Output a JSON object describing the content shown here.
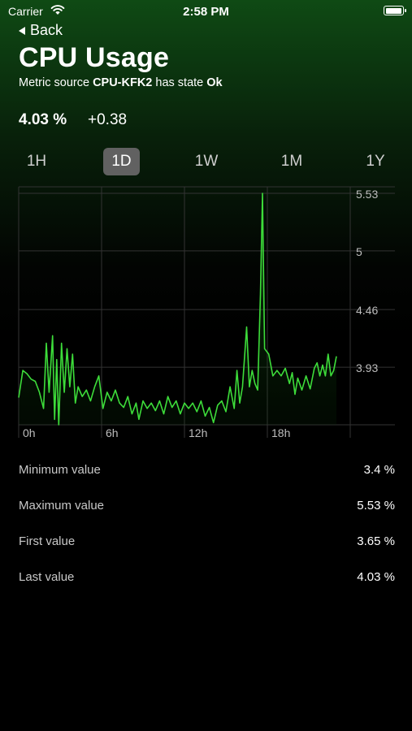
{
  "status_bar": {
    "carrier": "Carrier",
    "time": "2:58 PM",
    "battery_level": 1.0
  },
  "nav": {
    "back_label": "Back"
  },
  "header": {
    "title": "CPU Usage",
    "subtitle_prefix": "Metric source ",
    "source": "CPU-KFK2",
    "subtitle_middle": " has state ",
    "state": "Ok"
  },
  "summary": {
    "current_value": "4.03 %",
    "delta": "+0.38"
  },
  "ranges": [
    {
      "label": "1H",
      "active": false
    },
    {
      "label": "1D",
      "active": true
    },
    {
      "label": "1W",
      "active": false
    },
    {
      "label": "1M",
      "active": false
    },
    {
      "label": "1Y",
      "active": false
    }
  ],
  "colors": {
    "line": "#3ddc3a",
    "grid": "#333333",
    "active_range": "#616161"
  },
  "chart_data": {
    "type": "area",
    "x_labels": [
      "0h",
      "6h",
      "12h",
      "18h"
    ],
    "y_ticks": [
      5.53,
      5,
      4.46,
      3.93
    ],
    "y_tick_labels": [
      "5.53",
      "5",
      "4.46",
      "3.93"
    ],
    "ylim": [
      3.4,
      5.53
    ],
    "xlim": [
      0,
      24
    ],
    "grid": true,
    "legend": "none",
    "series": [
      {
        "values": [
          [
            0.0,
            3.65
          ],
          [
            0.3,
            3.9
          ],
          [
            0.6,
            3.87
          ],
          [
            0.9,
            3.82
          ],
          [
            1.2,
            3.8
          ],
          [
            1.5,
            3.7
          ],
          [
            1.8,
            3.55
          ],
          [
            2.0,
            4.15
          ],
          [
            2.2,
            3.7
          ],
          [
            2.45,
            4.22
          ],
          [
            2.6,
            3.45
          ],
          [
            2.75,
            4.0
          ],
          [
            2.9,
            3.4
          ],
          [
            3.1,
            4.15
          ],
          [
            3.3,
            3.7
          ],
          [
            3.5,
            4.1
          ],
          [
            3.7,
            3.75
          ],
          [
            3.9,
            4.05
          ],
          [
            4.1,
            3.6
          ],
          [
            4.3,
            3.75
          ],
          [
            4.6,
            3.66
          ],
          [
            4.9,
            3.72
          ],
          [
            5.2,
            3.62
          ],
          [
            5.5,
            3.75
          ],
          [
            5.8,
            3.85
          ],
          [
            6.1,
            3.55
          ],
          [
            6.4,
            3.7
          ],
          [
            6.7,
            3.62
          ],
          [
            7.0,
            3.72
          ],
          [
            7.3,
            3.6
          ],
          [
            7.6,
            3.56
          ],
          [
            7.9,
            3.66
          ],
          [
            8.2,
            3.5
          ],
          [
            8.5,
            3.6
          ],
          [
            8.7,
            3.45
          ],
          [
            9.0,
            3.62
          ],
          [
            9.3,
            3.55
          ],
          [
            9.6,
            3.6
          ],
          [
            9.9,
            3.53
          ],
          [
            10.2,
            3.62
          ],
          [
            10.5,
            3.5
          ],
          [
            10.8,
            3.66
          ],
          [
            11.1,
            3.56
          ],
          [
            11.4,
            3.62
          ],
          [
            11.7,
            3.5
          ],
          [
            12.0,
            3.6
          ],
          [
            12.3,
            3.55
          ],
          [
            12.6,
            3.6
          ],
          [
            12.9,
            3.52
          ],
          [
            13.2,
            3.62
          ],
          [
            13.5,
            3.48
          ],
          [
            13.8,
            3.56
          ],
          [
            14.1,
            3.42
          ],
          [
            14.4,
            3.58
          ],
          [
            14.7,
            3.62
          ],
          [
            15.0,
            3.52
          ],
          [
            15.3,
            3.75
          ],
          [
            15.6,
            3.55
          ],
          [
            15.8,
            3.9
          ],
          [
            16.0,
            3.6
          ],
          [
            16.2,
            3.75
          ],
          [
            16.5,
            4.3
          ],
          [
            16.7,
            3.75
          ],
          [
            16.9,
            3.9
          ],
          [
            17.1,
            3.78
          ],
          [
            17.3,
            3.72
          ],
          [
            17.5,
            4.6
          ],
          [
            17.65,
            5.53
          ],
          [
            17.8,
            4.1
          ],
          [
            18.1,
            4.05
          ],
          [
            18.4,
            3.85
          ],
          [
            18.7,
            3.9
          ],
          [
            19.0,
            3.85
          ],
          [
            19.3,
            3.92
          ],
          [
            19.6,
            3.78
          ],
          [
            19.8,
            3.88
          ],
          [
            20.0,
            3.68
          ],
          [
            20.2,
            3.83
          ],
          [
            20.5,
            3.72
          ],
          [
            20.8,
            3.85
          ],
          [
            21.1,
            3.73
          ],
          [
            21.4,
            3.92
          ],
          [
            21.6,
            3.97
          ],
          [
            21.8,
            3.85
          ],
          [
            22.0,
            3.95
          ],
          [
            22.2,
            3.85
          ],
          [
            22.4,
            4.05
          ],
          [
            22.6,
            3.85
          ],
          [
            22.8,
            3.9
          ],
          [
            23.0,
            4.03
          ]
        ]
      }
    ]
  },
  "stats": [
    {
      "label": "Minimum value",
      "value": "3.4 %"
    },
    {
      "label": "Maximum value",
      "value": "5.53 %"
    },
    {
      "label": "First value",
      "value": "3.65 %"
    },
    {
      "label": "Last value",
      "value": "4.03 %"
    }
  ]
}
